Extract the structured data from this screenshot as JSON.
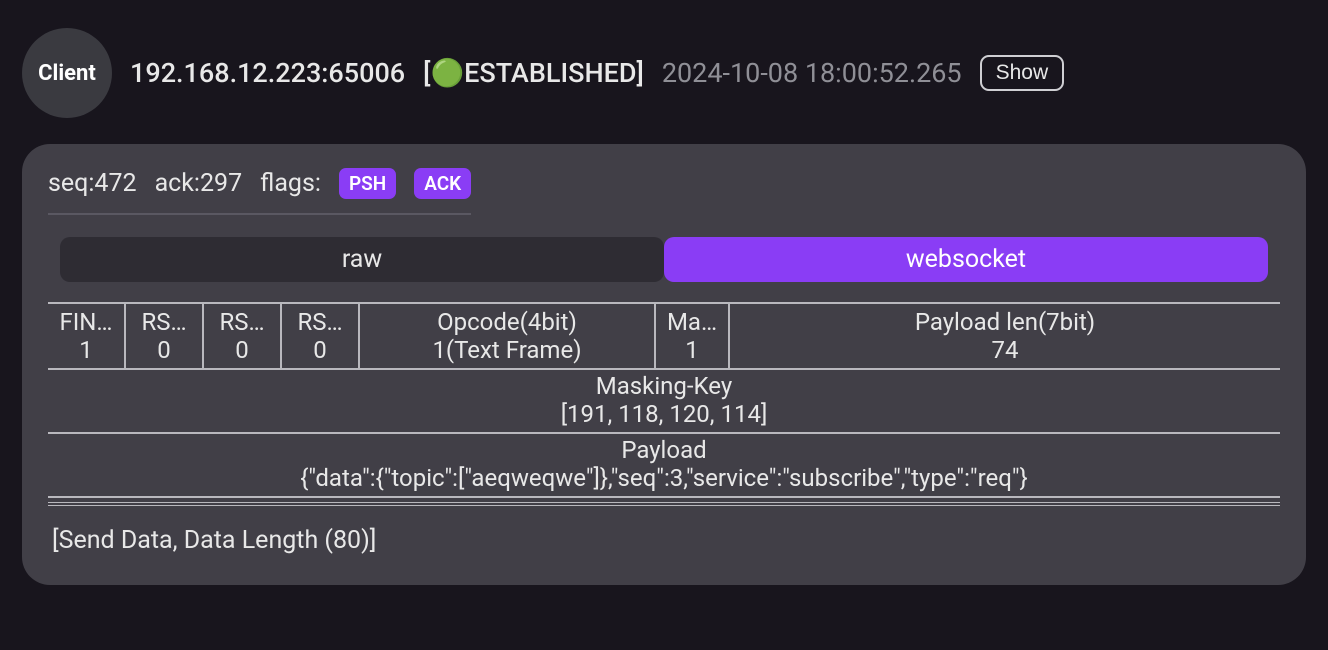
{
  "header": {
    "client_label": "Client",
    "address": "192.168.12.223:65006",
    "status_icon": "🟢",
    "status_text": "[🟢ESTABLISHED]",
    "timestamp": "2024-10-08 18:00:52.265",
    "show_label": "Show"
  },
  "meta": {
    "seq_label": "seq:472",
    "ack_label": "ack:297",
    "flags_label": "flags:",
    "flags": {
      "psh": "PSH",
      "ack": "ACK"
    }
  },
  "tabs": {
    "raw": "raw",
    "websocket": "websocket"
  },
  "ws": {
    "fin": {
      "hdr": "FIN…",
      "val": "1"
    },
    "rsv1": {
      "hdr": "RS…",
      "val": "0"
    },
    "rsv2": {
      "hdr": "RS…",
      "val": "0"
    },
    "rsv3": {
      "hdr": "RS…",
      "val": "0"
    },
    "opcode": {
      "hdr": "Opcode(4bit)",
      "val": "1(Text Frame)"
    },
    "mask": {
      "hdr": "Ma…",
      "val": "1"
    },
    "paylen": {
      "hdr": "Payload len(7bit)",
      "val": "74"
    },
    "masking_key": {
      "hdr": "Masking-Key",
      "val": "[191, 118, 120, 114]"
    },
    "payload": {
      "hdr": "Payload",
      "val": "{\"data\":{\"topic\":[\"aeqweqwe\"]},\"seq\":3,\"service\":\"subscribe\",\"type\":\"req\"}"
    }
  },
  "footer": {
    "line": "[Send Data, Data Length (80)]"
  }
}
